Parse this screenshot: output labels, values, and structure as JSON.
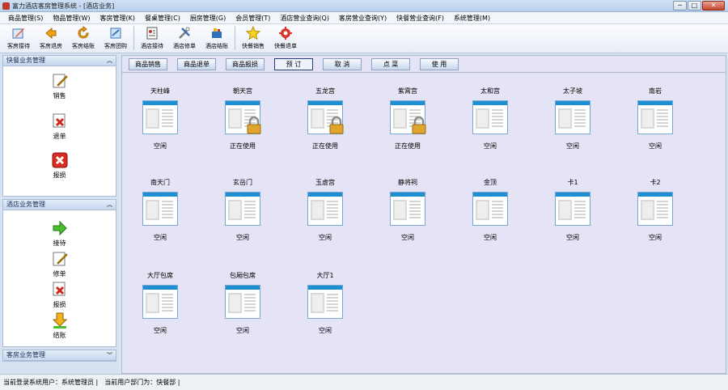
{
  "window": {
    "title": "富力酒店客房管理系统 - [酒店业务]",
    "buttons": [
      "─",
      "□",
      "✕"
    ]
  },
  "menu": [
    "商品管理(S)",
    "物品管理(W)",
    "客房管理(K)",
    "餐桌管理(C)",
    "厨房管理(G)",
    "会员管理(T)",
    "酒店营业查询(Q)",
    "客房营业查询(Y)",
    "快餐营业查询(F)",
    "系统管理(M)"
  ],
  "toolbar": {
    "group1": [
      {
        "label": "客房接待",
        "icon": "reception-pen-icon"
      },
      {
        "label": "客房退房",
        "icon": "checkout-arrow-icon"
      },
      {
        "label": "客房结账",
        "icon": "settle-arrow-icon"
      },
      {
        "label": "客房团购",
        "icon": "group-buy-icon"
      }
    ],
    "group2": [
      {
        "label": "酒店接待",
        "icon": "id-card-icon"
      },
      {
        "label": "酒店修单",
        "icon": "tools-icon"
      },
      {
        "label": "酒店结账",
        "icon": "cash-register-icon"
      }
    ],
    "group3": [
      {
        "label": "快餐销售",
        "icon": "star-icon"
      },
      {
        "label": "快餐退单",
        "icon": "gear-refund-icon"
      }
    ]
  },
  "sidebar": {
    "panel1": {
      "title": "快餐业务管理",
      "items": [
        {
          "label": "销售",
          "icon": "edit-icon"
        },
        {
          "label": "退单",
          "icon": "red-x-icon"
        },
        {
          "label": "报损",
          "icon": "delete-box-icon"
        }
      ]
    },
    "panel2": {
      "title": "酒店业务管理",
      "items": [
        {
          "label": "接待",
          "icon": "green-arrow-icon"
        },
        {
          "label": "修单",
          "icon": "edit-icon"
        },
        {
          "label": "报损",
          "icon": "red-x-doc-icon"
        },
        {
          "label": "结账",
          "icon": "download-arrow-icon"
        }
      ]
    },
    "panel3": {
      "title": "客房业务管理"
    }
  },
  "tabs": [
    "商品销售",
    "商品退单",
    "商品报损",
    "预 订",
    "取 消",
    "点 菜",
    "使 用"
  ],
  "rooms": [
    {
      "name": "天柱峰",
      "status": "空闲",
      "locked": false
    },
    {
      "name": "朝天宫",
      "status": "正在使用",
      "locked": true
    },
    {
      "name": "五龙宫",
      "status": "正在使用",
      "locked": true
    },
    {
      "name": "紫霄宫",
      "status": "正在使用",
      "locked": true
    },
    {
      "name": "太和宫",
      "status": "空闲",
      "locked": false
    },
    {
      "name": "太子坡",
      "status": "空闲",
      "locked": false
    },
    {
      "name": "南岩",
      "status": "空闲",
      "locked": false
    },
    {
      "name": "南天门",
      "status": "空闲",
      "locked": false
    },
    {
      "name": "玄岳门",
      "status": "空闲",
      "locked": false
    },
    {
      "name": "玉虚宫",
      "status": "空闲",
      "locked": false
    },
    {
      "name": "静将祠",
      "status": "空闲",
      "locked": false
    },
    {
      "name": "金顶",
      "status": "空闲",
      "locked": false
    },
    {
      "name": "卡1",
      "status": "空闲",
      "locked": false
    },
    {
      "name": "卡2",
      "status": "空闲",
      "locked": false
    },
    {
      "name": "大厅包席",
      "status": "空闲",
      "locked": false
    },
    {
      "name": "包厢包席",
      "status": "空闲",
      "locked": false
    },
    {
      "name": "大厅1",
      "status": "空闲",
      "locked": false
    }
  ],
  "statusbar": {
    "user": "当前登录系统用户：系统管理员 |",
    "dept": "当前用户部门为：快餐部 |"
  },
  "colors": {
    "main_bg": "#e4e4f6",
    "sidebar_bg": "#d6e2f1",
    "room_header": "#1e8fd0",
    "lock_gold": "#e0a52a"
  }
}
